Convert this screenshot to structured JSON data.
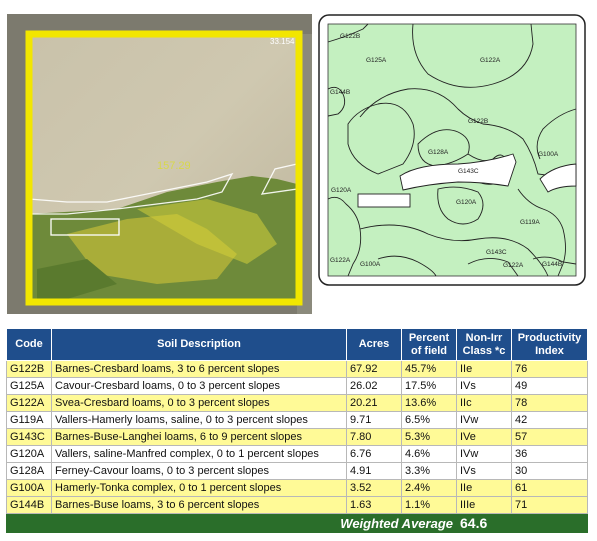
{
  "aerial": {
    "tract_label": "157.29",
    "corner_label": "33.154"
  },
  "soil_map": {
    "labels": [
      "G122B",
      "G125A",
      "G122A",
      "G144B",
      "G122B",
      "G128A",
      "G143C",
      "G100A",
      "G120A",
      "G120A",
      "G119A",
      "G143C",
      "G122A",
      "G144B",
      "G122A",
      "G100A"
    ]
  },
  "table": {
    "headers": {
      "code": "Code",
      "description": "Soil Description",
      "acres": "Acres",
      "percent": "Percent of field",
      "class": "Non-Irr Class *c",
      "pi": "Productivity Index"
    },
    "rows": [
      {
        "code": "G122B",
        "description": "Barnes-Cresbard loams, 3 to 6 percent slopes",
        "acres": "67.92",
        "percent": "45.7%",
        "class": "IIe",
        "pi": "76"
      },
      {
        "code": "G125A",
        "description": "Cavour-Cresbard loams, 0 to 3 percent slopes",
        "acres": "26.02",
        "percent": "17.5%",
        "class": "IVs",
        "pi": "49"
      },
      {
        "code": "G122A",
        "description": "Svea-Cresbard loams, 0 to 3 percent slopes",
        "acres": "20.21",
        "percent": "13.6%",
        "class": "IIc",
        "pi": "78"
      },
      {
        "code": "G119A",
        "description": "Vallers-Hamerly loams, saline, 0 to 3 percent slopes",
        "acres": "9.71",
        "percent": "6.5%",
        "class": "IVw",
        "pi": "42"
      },
      {
        "code": "G143C",
        "description": "Barnes-Buse-Langhei loams, 6 to 9 percent slopes",
        "acres": "7.80",
        "percent": "5.3%",
        "class": "IVe",
        "pi": "57"
      },
      {
        "code": "G120A",
        "description": "Vallers, saline-Manfred complex, 0 to 1 percent slopes",
        "acres": "6.76",
        "percent": "4.6%",
        "class": "IVw",
        "pi": "36"
      },
      {
        "code": "G128A",
        "description": "Ferney-Cavour loams, 0 to 3 percent slopes",
        "acres": "4.91",
        "percent": "3.3%",
        "class": "IVs",
        "pi": "30"
      },
      {
        "code": "G100A",
        "description": "Hamerly-Tonka complex, 0 to 1 percent slopes",
        "acres": "3.52",
        "percent": "2.4%",
        "class": "IIe",
        "pi": "61"
      },
      {
        "code": "G144B",
        "description": "Barnes-Buse loams, 3 to 6 percent slopes",
        "acres": "1.63",
        "percent": "1.1%",
        "class": "IIIe",
        "pi": "71"
      }
    ],
    "footer": {
      "label": "Weighted Average",
      "value": "64.6"
    }
  },
  "colors": {
    "header_blue": "#1f4e8c",
    "row_yellow": "#fffa97",
    "footer_green": "#2a6e2a",
    "map_green": "#c4f0c0",
    "boundary_yellow": "#f2e600"
  }
}
